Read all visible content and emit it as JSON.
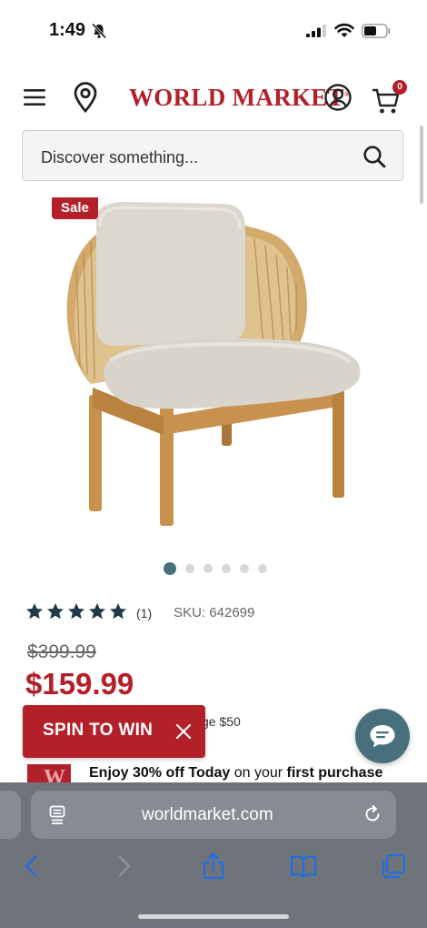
{
  "status_bar": {
    "time": "1:49"
  },
  "header": {
    "brand": "WORLD MARKET",
    "brand_mark": "®",
    "cart_count": "0"
  },
  "search": {
    "placeholder": "Discover something..."
  },
  "product": {
    "sale_badge": "Sale",
    "rating_stars": 5,
    "rating_count": "(1)",
    "sku": "SKU: 642699",
    "original_price": "$399.99",
    "sale_price": "$159.99",
    "partial_text": "ge $50",
    "carousel": {
      "total": 6,
      "active": 0
    }
  },
  "spin_to_win": {
    "label": "SPIN TO WIN"
  },
  "promo": {
    "enjoy": "Enjoy 30% off Today",
    "on_your": " on your ",
    "first_purchase": "first purchase"
  },
  "safari": {
    "url": "worldmarket.com"
  },
  "colors": {
    "brand_red": "#b3202a",
    "accent_teal": "#47707c",
    "safari_bar": "#6f747b",
    "toolbar_blue": "#1f6fe0"
  }
}
